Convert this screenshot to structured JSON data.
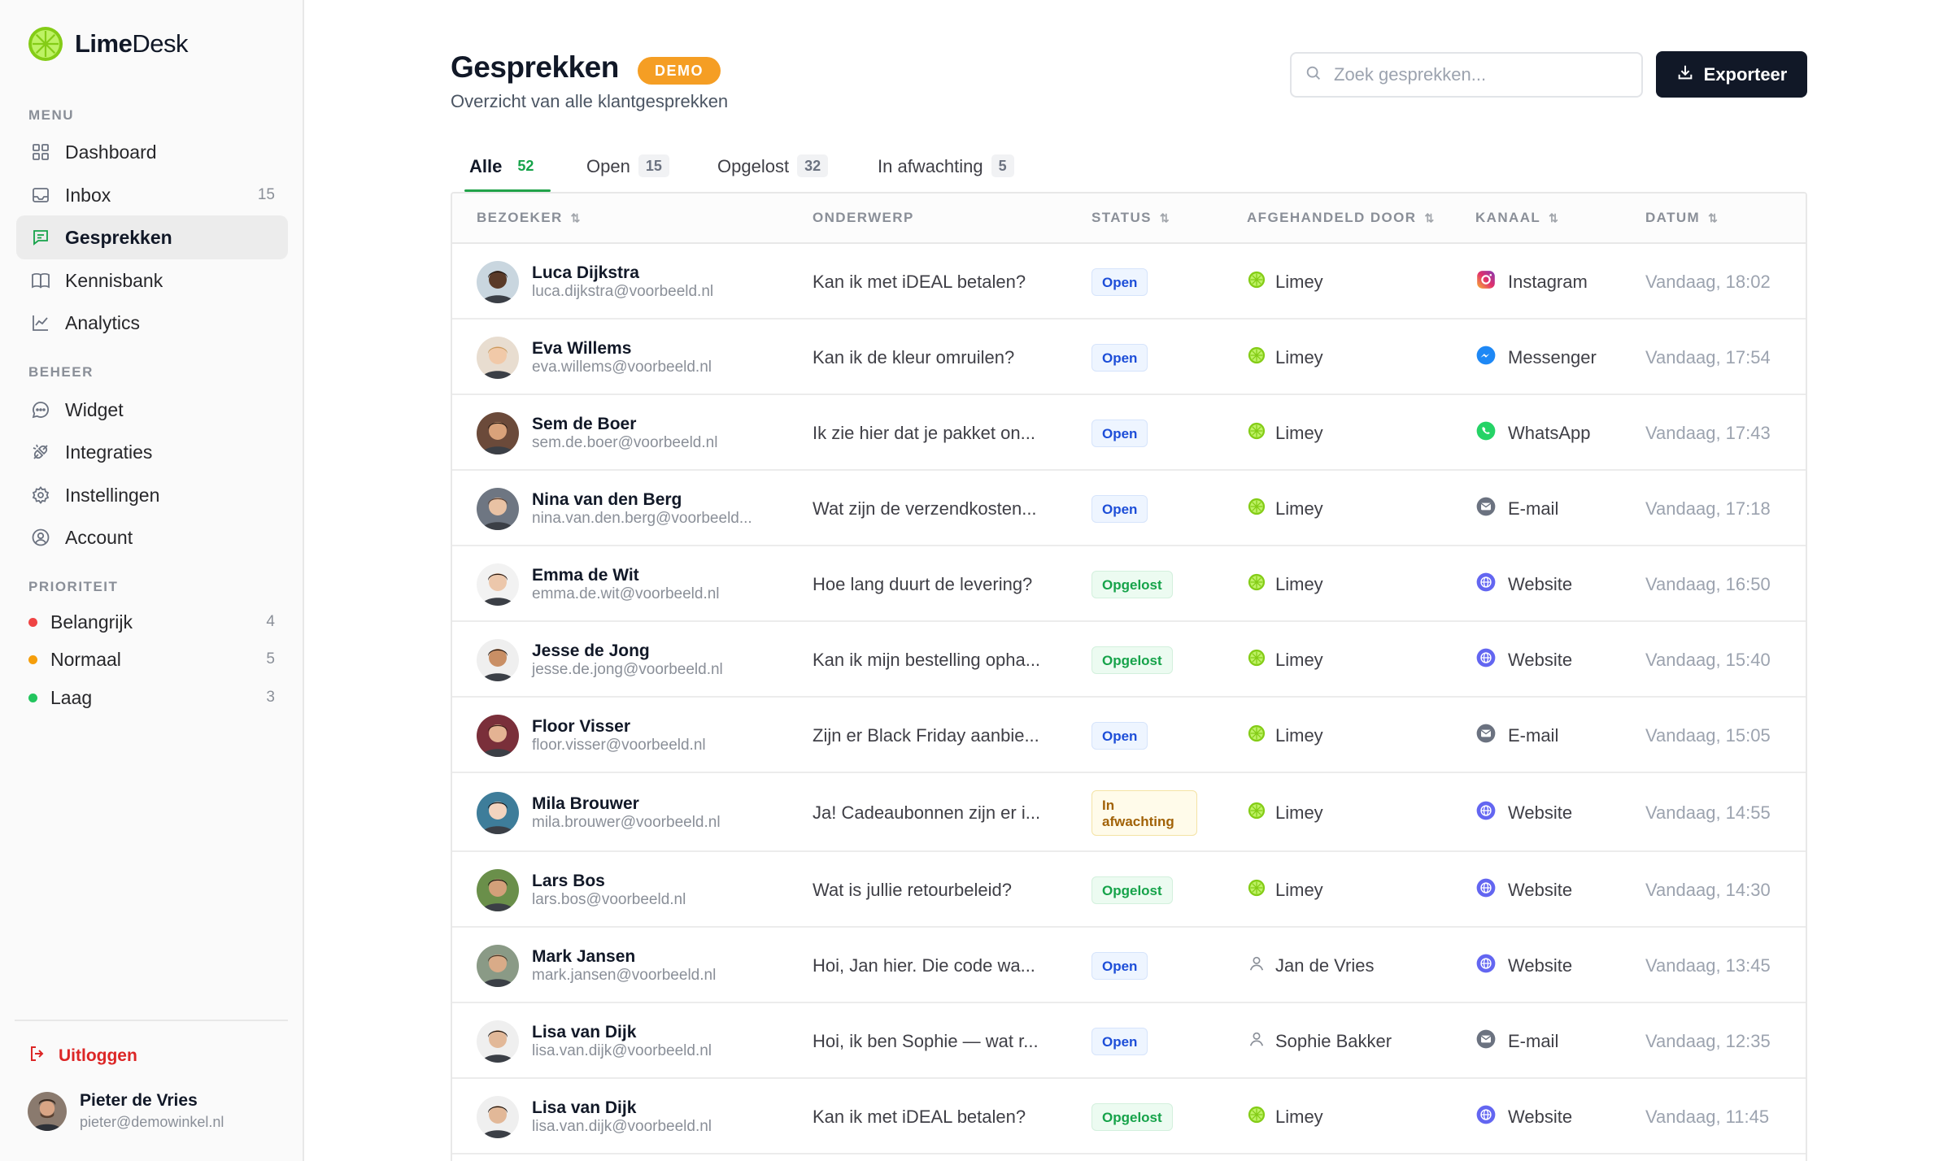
{
  "brand": {
    "name_bold": "Lime",
    "name_rest": "Desk",
    "color": "#a3e635"
  },
  "sidebar": {
    "menu_label": "MENU",
    "menu_items": [
      {
        "label": "Dashboard",
        "icon": "grid-icon",
        "count": ""
      },
      {
        "label": "Inbox",
        "icon": "inbox-icon",
        "count": "15"
      },
      {
        "label": "Gesprekken",
        "icon": "chat-icon",
        "count": "",
        "active": true
      },
      {
        "label": "Kennisbank",
        "icon": "book-icon",
        "count": ""
      },
      {
        "label": "Analytics",
        "icon": "chart-line-icon",
        "count": ""
      }
    ],
    "manage_label": "BEHEER",
    "manage_items": [
      {
        "label": "Widget",
        "icon": "chat-bubble-icon"
      },
      {
        "label": "Integraties",
        "icon": "plug-icon"
      },
      {
        "label": "Instellingen",
        "icon": "gear-icon"
      },
      {
        "label": "Account",
        "icon": "user-circle-icon"
      }
    ],
    "priority_label": "PRIORITEIT",
    "priority_items": [
      {
        "label": "Belangrijk",
        "count": "4",
        "color": "#ef4444"
      },
      {
        "label": "Normaal",
        "count": "5",
        "color": "#f59e0b"
      },
      {
        "label": "Laag",
        "count": "3",
        "color": "#22c55e"
      }
    ],
    "logout_label": "Uitloggen",
    "user": {
      "name": "Pieter de Vries",
      "email": "pieter@demowinkel.nl"
    }
  },
  "header": {
    "title": "Gesprekken",
    "badge": "DEMO",
    "subtitle": "Overzicht van alle klantgesprekken",
    "search_placeholder": "Zoek gesprekken...",
    "export_label": "Exporteer"
  },
  "tabs": [
    {
      "label": "Alle",
      "count": "52",
      "active": true
    },
    {
      "label": "Open",
      "count": "15"
    },
    {
      "label": "Opgelost",
      "count": "32"
    },
    {
      "label": "In afwachting",
      "count": "5"
    }
  ],
  "table": {
    "columns": [
      "BEZOEKER",
      "ONDERWERP",
      "STATUS",
      "AFGEHANDELD DOOR",
      "KANAAL",
      "DATUM"
    ],
    "rows": [
      {
        "name": "Luca Dijkstra",
        "email": "luca.dijkstra@voorbeeld.nl",
        "subject": "Kan ik met iDEAL betalen?",
        "status": "Open",
        "status_type": "open",
        "handler": "Limey",
        "handler_type": "bot",
        "channel": "Instagram",
        "channel_icon": "instagram-icon",
        "date": "Vandaag, 18:02",
        "skin": "#5a3a28",
        "hair": "#1c1410",
        "bg": "#c9d6df"
      },
      {
        "name": "Eva Willems",
        "email": "eva.willems@voorbeeld.nl",
        "subject": "Kan ik de kleur omruilen?",
        "status": "Open",
        "status_type": "open",
        "handler": "Limey",
        "handler_type": "bot",
        "channel": "Messenger",
        "channel_icon": "messenger-icon",
        "date": "Vandaag, 17:54",
        "skin": "#f1c9a8",
        "hair": "#c99a5e",
        "bg": "#e8ddd0"
      },
      {
        "name": "Sem de Boer",
        "email": "sem.de.boer@voorbeeld.nl",
        "subject": "Ik zie hier dat je pakket on...",
        "status": "Open",
        "status_type": "open",
        "handler": "Limey",
        "handler_type": "bot",
        "channel": "WhatsApp",
        "channel_icon": "whatsapp-icon",
        "date": "Vandaag, 17:43",
        "skin": "#d9a27a",
        "hair": "#2b1d14",
        "bg": "#6b4a3a"
      },
      {
        "name": "Nina van den Berg",
        "email": "nina.van.den.berg@voorbeeld...",
        "subject": "Wat zijn de verzendkosten...",
        "status": "Open",
        "status_type": "open",
        "handler": "Limey",
        "handler_type": "bot",
        "channel": "E-mail",
        "channel_icon": "mail-icon",
        "date": "Vandaag, 17:18",
        "skin": "#e9c2a4",
        "hair": "#5c4030",
        "bg": "#6e7682"
      },
      {
        "name": "Emma de Wit",
        "email": "emma.de.wit@voorbeeld.nl",
        "subject": "Hoe lang duurt de levering?",
        "status": "Opgelost",
        "status_type": "solved",
        "handler": "Limey",
        "handler_type": "bot",
        "channel": "Website",
        "channel_icon": "globe-icon",
        "date": "Vandaag, 16:50",
        "skin": "#ecc7ab",
        "hair": "#2a1a12",
        "bg": "#f2f2f2"
      },
      {
        "name": "Jesse de Jong",
        "email": "jesse.de.jong@voorbeeld.nl",
        "subject": "Kan ik mijn bestelling opha...",
        "status": "Opgelost",
        "status_type": "solved",
        "handler": "Limey",
        "handler_type": "bot",
        "channel": "Website",
        "channel_icon": "globe-icon",
        "date": "Vandaag, 15:40",
        "skin": "#c98f65",
        "hair": "#22160f",
        "bg": "#efefef"
      },
      {
        "name": "Floor Visser",
        "email": "floor.visser@voorbeeld.nl",
        "subject": "Zijn er Black Friday aanbie...",
        "status": "Open",
        "status_type": "open",
        "handler": "Limey",
        "handler_type": "bot",
        "channel": "E-mail",
        "channel_icon": "mail-icon",
        "date": "Vandaag, 15:05",
        "skin": "#e4b393",
        "hair": "#3a1e16",
        "bg": "#7a2f3a"
      },
      {
        "name": "Mila Brouwer",
        "email": "mila.brouwer@voorbeeld.nl",
        "subject": "Ja! Cadeaubonnen zijn er i...",
        "status": "In afwachting",
        "status_type": "waiting",
        "handler": "Limey",
        "handler_type": "bot",
        "channel": "Website",
        "channel_icon": "globe-icon",
        "date": "Vandaag, 14:55",
        "skin": "#f3d4bf",
        "hair": "#101418",
        "bg": "#3e7d9a"
      },
      {
        "name": "Lars Bos",
        "email": "lars.bos@voorbeeld.nl",
        "subject": "Wat is jullie retourbeleid?",
        "status": "Opgelost",
        "status_type": "solved",
        "handler": "Limey",
        "handler_type": "bot",
        "channel": "Website",
        "channel_icon": "globe-icon",
        "date": "Vandaag, 14:30",
        "skin": "#d3a07a",
        "hair": "#1d1612",
        "bg": "#6a8f4a"
      },
      {
        "name": "Mark Jansen",
        "email": "mark.jansen@voorbeeld.nl",
        "subject": "Hoi, Jan hier. Die code wa...",
        "status": "Open",
        "status_type": "open",
        "handler": "Jan de Vries",
        "handler_type": "human",
        "channel": "Website",
        "channel_icon": "globe-icon",
        "date": "Vandaag, 13:45",
        "skin": "#d9ab88",
        "hair": "#4a3626",
        "bg": "#8a9a86"
      },
      {
        "name": "Lisa van Dijk",
        "email": "lisa.van.dijk@voorbeeld.nl",
        "subject": "Hoi, ik ben Sophie — wat r...",
        "status": "Open",
        "status_type": "open",
        "handler": "Sophie Bakker",
        "handler_type": "human",
        "channel": "E-mail",
        "channel_icon": "mail-icon",
        "date": "Vandaag, 12:35",
        "skin": "#e2b898",
        "hair": "#1b120d",
        "bg": "#efefef"
      },
      {
        "name": "Lisa van Dijk",
        "email": "lisa.van.dijk@voorbeeld.nl",
        "subject": "Kan ik met iDEAL betalen?",
        "status": "Opgelost",
        "status_type": "solved",
        "handler": "Limey",
        "handler_type": "bot",
        "channel": "Website",
        "channel_icon": "globe-icon",
        "date": "Vandaag, 11:45",
        "skin": "#e2b898",
        "hair": "#1b120d",
        "bg": "#efefef"
      }
    ]
  }
}
